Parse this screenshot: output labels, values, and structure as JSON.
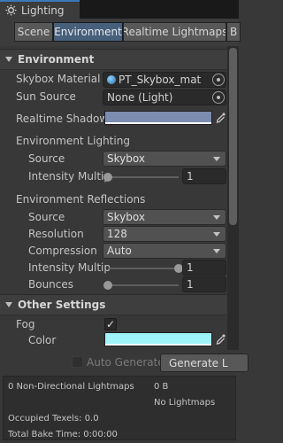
{
  "window": {
    "title": "Lighting",
    "icon": "sun-icon"
  },
  "tabs": [
    {
      "label": "Scene",
      "active": false
    },
    {
      "label": "Environment",
      "active": true
    },
    {
      "label": "Realtime Lightmaps",
      "active": false
    },
    {
      "label": "B",
      "active": false
    }
  ],
  "environment": {
    "header": "Environment",
    "skybox_material": {
      "label": "Skybox Material",
      "value": "PT_Skybox_mat"
    },
    "sun_source": {
      "label": "Sun Source",
      "value": "None (Light)"
    },
    "realtime_shadow": {
      "label": "Realtime Shadow",
      "color": "#7d8db2"
    },
    "lighting": {
      "heading": "Environment Lighting",
      "source": {
        "label": "Source",
        "value": "Skybox"
      },
      "intensity": {
        "label": "Intensity Multip",
        "value": "1",
        "fraction": 0.0
      }
    },
    "reflections": {
      "heading": "Environment Reflections",
      "source": {
        "label": "Source",
        "value": "Skybox"
      },
      "resolution": {
        "label": "Resolution",
        "value": "128"
      },
      "compression": {
        "label": "Compression",
        "value": "Auto"
      },
      "intensity": {
        "label": "Intensity Multip",
        "value": "1",
        "fraction": 1.0
      },
      "bounces": {
        "label": "Bounces",
        "value": "1",
        "fraction": 0.0
      }
    }
  },
  "other_settings": {
    "header": "Other Settings",
    "fog": {
      "label": "Fog",
      "checked": true
    },
    "fog_color": {
      "label": "Color",
      "color": "#9ef4f8"
    }
  },
  "generate": {
    "auto_label": "Auto Generate",
    "button_label": "Generate L"
  },
  "stats": {
    "lightmaps": "0 Non-Directional Lightmaps",
    "size": "0 B",
    "no_lightmaps": "No Lightmaps",
    "occupied_texels": "Occupied Texels: 0.0",
    "bake_time": "Total Bake Time: 0:00:00"
  }
}
